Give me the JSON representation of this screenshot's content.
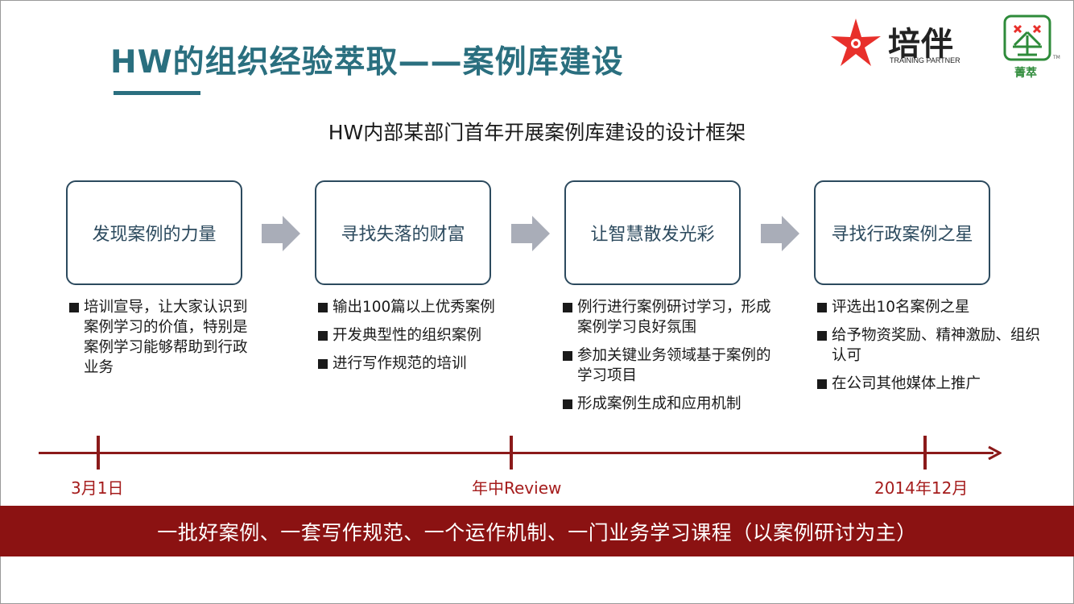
{
  "slide": {
    "title": "HW的组织经验萃取——案例库建设",
    "subtitle": "HW内部某部门首年开展案例库建设的设计框架"
  },
  "logos": {
    "peiban": {
      "name": "培伴",
      "tagline": "TRAINING PARTNER",
      "color": "#e8302b"
    },
    "jingcui": {
      "name": "菁萃",
      "tm": "TM",
      "color": "#2e8b3a"
    }
  },
  "stages": [
    {
      "label": "发现案例的力量",
      "bullets": [
        "培训宣导，让大家认识到案例学习的价值，特别是案例学习能够帮助到行政业务"
      ]
    },
    {
      "label": "寻找失落的财富",
      "bullets": [
        "输出100篇以上优秀案例",
        "开发典型性的组织案例",
        "进行写作规范的培训"
      ]
    },
    {
      "label": "让智慧散发光彩",
      "bullets": [
        "例行进行案例研讨学习，形成案例学习良好氛围",
        "参加关键业务领域基于案例的学习项目",
        "形成案例生成和应用机制"
      ]
    },
    {
      "label": "寻找行政案例之星",
      "bullets": [
        "评选出10名案例之星",
        "给予物资奖励、精神激励、组织认可",
        "在公司其他媒体上推广"
      ]
    }
  ],
  "timeline": {
    "color": "#8b1a1a",
    "ticks": [
      {
        "label": "3月1日"
      },
      {
        "label": "年中Review"
      },
      {
        "label": "2014年12月"
      }
    ]
  },
  "banner": {
    "text": "一批好案例、一套写作规范、一个运作机制、一门业务学习课程（以案例研讨为主）",
    "color": "#8b1212"
  }
}
